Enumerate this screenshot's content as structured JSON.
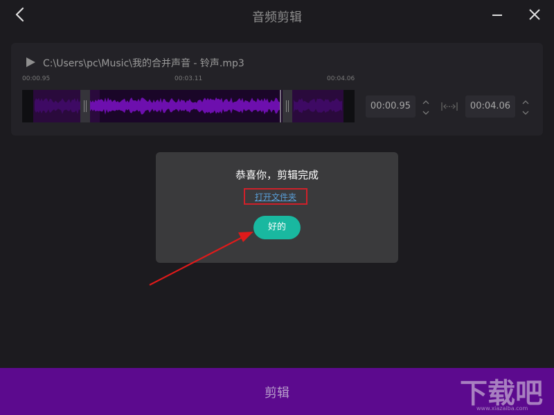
{
  "window": {
    "title": "音频剪辑",
    "back_icon": "chevron-left-icon",
    "minimize_icon": "minimize-icon",
    "close_icon": "close-icon"
  },
  "editor": {
    "play_icon": "play-icon",
    "file_path": "C:\\Users\\pc\\Music\\我的合并声音 - 铃声.mp3",
    "timeline_ticks": [
      "00:00.95",
      "00:03.11",
      "00:04.06"
    ],
    "start_time": "00:00.95",
    "end_time": "00:04.06",
    "link_icon": "range-link-icon"
  },
  "dialog": {
    "message": "恭喜你，剪辑完成",
    "open_folder_link": "打开文件夹",
    "ok_label": "好的"
  },
  "bottom_bar": {
    "cut_label": "剪辑"
  },
  "watermark": {
    "text": "下载吧",
    "url": "www.xiazaiba.com"
  },
  "colors": {
    "background": "#1c1b1f",
    "panel": "#232227",
    "waveform": "#6d0fae",
    "accent_teal": "#19b8a0",
    "cut_bar": "#5c0a8e",
    "highlight_box": "#d0202a",
    "arrow": "#e01a1a",
    "link": "#5a9fd8"
  }
}
